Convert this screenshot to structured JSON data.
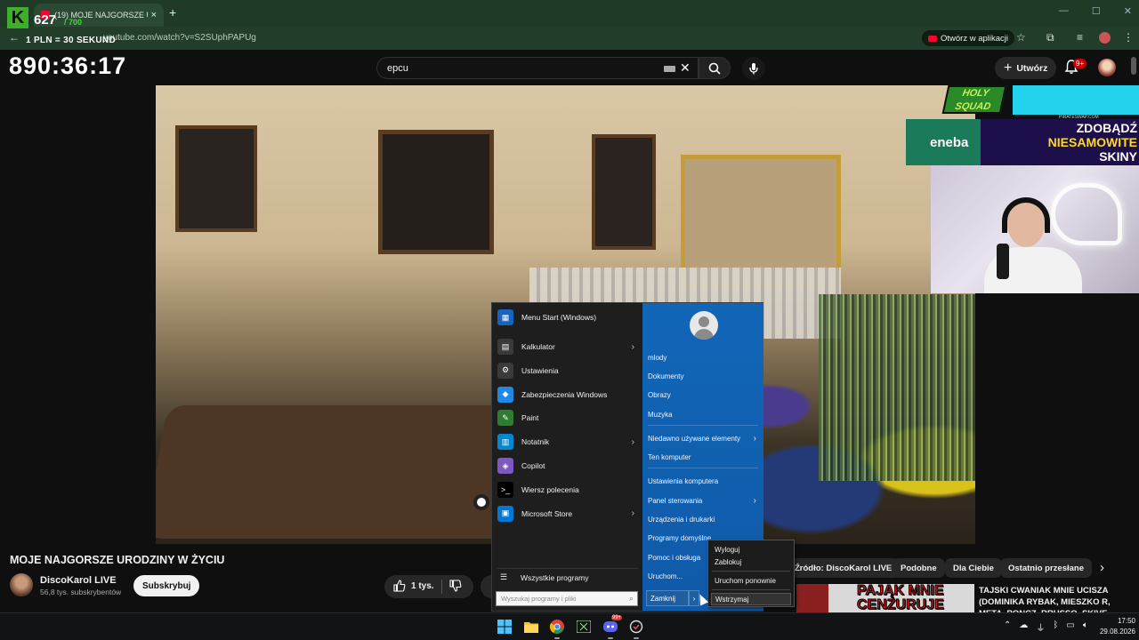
{
  "browser": {
    "tab_title": "(19) MOJE NAJGORSZE URODZ",
    "tab_close": "×",
    "new_tab": "+",
    "url": "youtube.com/watch?v=S2SUphPAPUg",
    "open_in_app_label": "Otwórz w aplikacji"
  },
  "stream_overlay": {
    "logo_letter": "K",
    "donation_count": "627",
    "donation_goal": "/ 700",
    "rate_text": "1 PLN = 30 SEKUND",
    "timer": "890:36:17",
    "hq_logo_text": "HOLY SQUAD",
    "pirate_text": "PIRATESWAP.COM",
    "eneba_text": "eneba",
    "skins_line1": "ZDOBĄDŹ",
    "skins_line2": "NIESAMOWITE",
    "skins_line3": "SKINY"
  },
  "youtube": {
    "search_value": "epcu",
    "create_label": "Utwórz",
    "notif_badge": "9+",
    "video_title": "MOJE NAJGORSZE URODZINY W ŻYCIU",
    "channel_name": "DiscoKarol LIVE",
    "channel_subs": "56,8 tys. subskrybentów",
    "subscribe_label": "Subskrybuj",
    "like_count": "1 tys.",
    "chips": [
      "Źródło: DiscoKarol LIVE",
      "Podobne",
      "Dla Ciebie",
      "Ostatnio przesłane"
    ],
    "rec_thumb_text": "PAJĄK MNIE CENZURUJE",
    "rec_title": "TAJSKI CWANIAK MNIE UCISZA (DOMINIKA RYBAK, MIESZKO R, META, PONCZ, RRUSSO, SKIVE"
  },
  "start_menu": {
    "left_items": [
      {
        "label": "Menu Start (Windows)",
        "icon": "start-icon",
        "color": "#1565c0",
        "arrow": false
      },
      {
        "label": "Kalkulator",
        "icon": "calculator-icon",
        "color": "#3a3a3a",
        "arrow": true
      },
      {
        "label": "Ustawienia",
        "icon": "gear-icon",
        "color": "#3a3a3a",
        "arrow": false
      },
      {
        "label": "Zabezpieczenia Windows",
        "icon": "shield-icon",
        "color": "#1e88e5",
        "arrow": false
      },
      {
        "label": "Paint",
        "icon": "paint-icon",
        "color": "#2e7d32",
        "arrow": false
      },
      {
        "label": "Notatnik",
        "icon": "notepad-icon",
        "color": "#0288d1",
        "arrow": true
      },
      {
        "label": "Copilot",
        "icon": "copilot-icon",
        "color": "#7e57c2",
        "arrow": false
      },
      {
        "label": "Wiersz polecenia",
        "icon": "terminal-icon",
        "color": "#000000",
        "arrow": false
      },
      {
        "label": "Microsoft Store",
        "icon": "store-icon",
        "color": "#0078d4",
        "arrow": true
      }
    ],
    "all_programs": "Wszystkie programy",
    "search_placeholder": "Wyszukaj programy i pliki",
    "right_items": [
      {
        "label": "mlody",
        "arrow": false
      },
      {
        "label": "Dokumenty",
        "arrow": false
      },
      {
        "label": "Obrazy",
        "arrow": false
      },
      {
        "label": "Muzyka",
        "arrow": false
      },
      {
        "label": "Niedawno używane elementy",
        "arrow": true
      },
      {
        "label": "Ten komputer",
        "arrow": false
      },
      {
        "label": "Ustawienia komputera",
        "arrow": false
      },
      {
        "label": "Panel sterowania",
        "arrow": true
      },
      {
        "label": "Urządzenia i drukarki",
        "arrow": false
      },
      {
        "label": "Programy domyślne",
        "arrow": false
      },
      {
        "label": "Pomoc i obsługa",
        "arrow": false
      },
      {
        "label": "Uruchom...",
        "arrow": false
      }
    ],
    "shutdown_label": "Zamknij",
    "power_menu": [
      "Wyloguj",
      "Zablokuj",
      "Uruchom ponownie",
      "Wstrzymaj"
    ]
  },
  "taskbar": {
    "time": "17:50",
    "date": "29.08.2026",
    "discord_badge": "99+"
  }
}
